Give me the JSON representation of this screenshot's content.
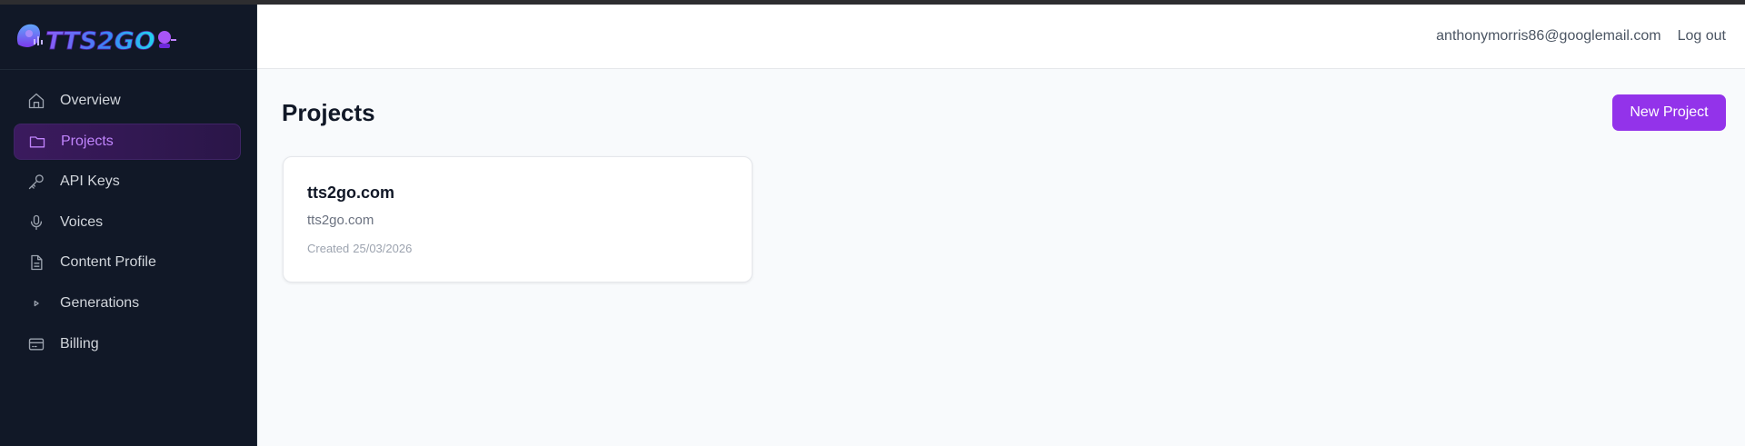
{
  "brand": {
    "logo_text": "TTS2GO"
  },
  "sidebar": {
    "items": [
      {
        "label": "Overview",
        "icon": "home-icon",
        "active": false
      },
      {
        "label": "Projects",
        "icon": "folder-icon",
        "active": true
      },
      {
        "label": "API Keys",
        "icon": "key-icon",
        "active": false
      },
      {
        "label": "Voices",
        "icon": "microphone-icon",
        "active": false
      },
      {
        "label": "Content Profile",
        "icon": "document-icon",
        "active": false
      },
      {
        "label": "Generations",
        "icon": "play-icon",
        "active": false
      },
      {
        "label": "Billing",
        "icon": "credit-card-icon",
        "active": false
      }
    ]
  },
  "header": {
    "email": "anthonymorris86@googlemail.com",
    "logout_label": "Log out"
  },
  "main": {
    "title": "Projects",
    "new_project_label": "New Project",
    "projects": [
      {
        "name": "tts2go.com",
        "domain": "tts2go.com",
        "created_label": "Created",
        "created_date": "25/03/2026"
      }
    ]
  },
  "colors": {
    "accent": "#9333ea",
    "sidebar_bg": "#111827",
    "active_text": "#c084fc"
  }
}
